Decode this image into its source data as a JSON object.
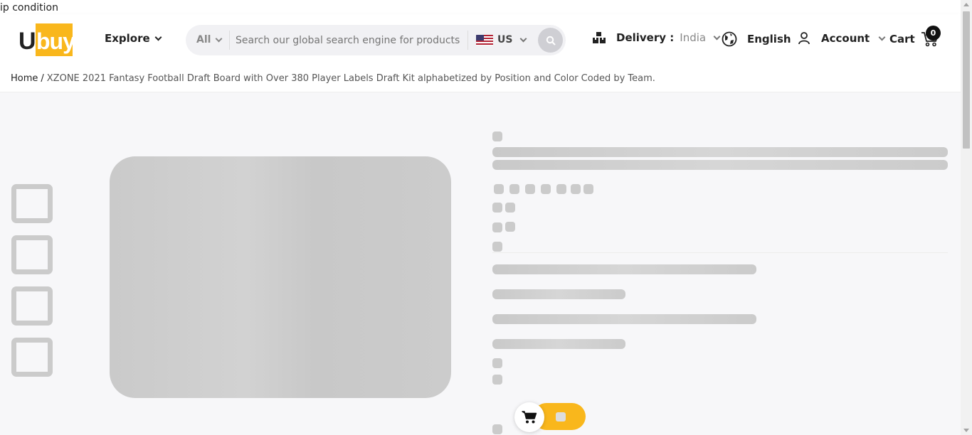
{
  "top_note": "ip condition",
  "header": {
    "logo": {
      "letter": "U",
      "word": "buy"
    },
    "explore_label": "Explore",
    "search": {
      "category": "All",
      "placeholder": "Search our global search engine for products",
      "country_code": "US"
    },
    "delivery": {
      "label": "Delivery :",
      "country": "India"
    },
    "language": "English",
    "account_label": "Account",
    "cart_label": "Cart",
    "cart_count": "0"
  },
  "breadcrumb": {
    "home": "Home",
    "separator": "/",
    "current": "XZONE 2021 Fantasy Football Draft Board with Over 380 Player Labels Draft Kit alphabetized by Position and Color Coded by Team."
  },
  "colors": {
    "brand_yellow": "#f9b71c",
    "skeleton": "#cbcbcb",
    "background": "#f7f7f9"
  },
  "icons": {
    "search": "search-icon",
    "delivery": "boxes-icon",
    "language": "globe-icon",
    "account": "user-icon",
    "cart": "cart-icon"
  }
}
